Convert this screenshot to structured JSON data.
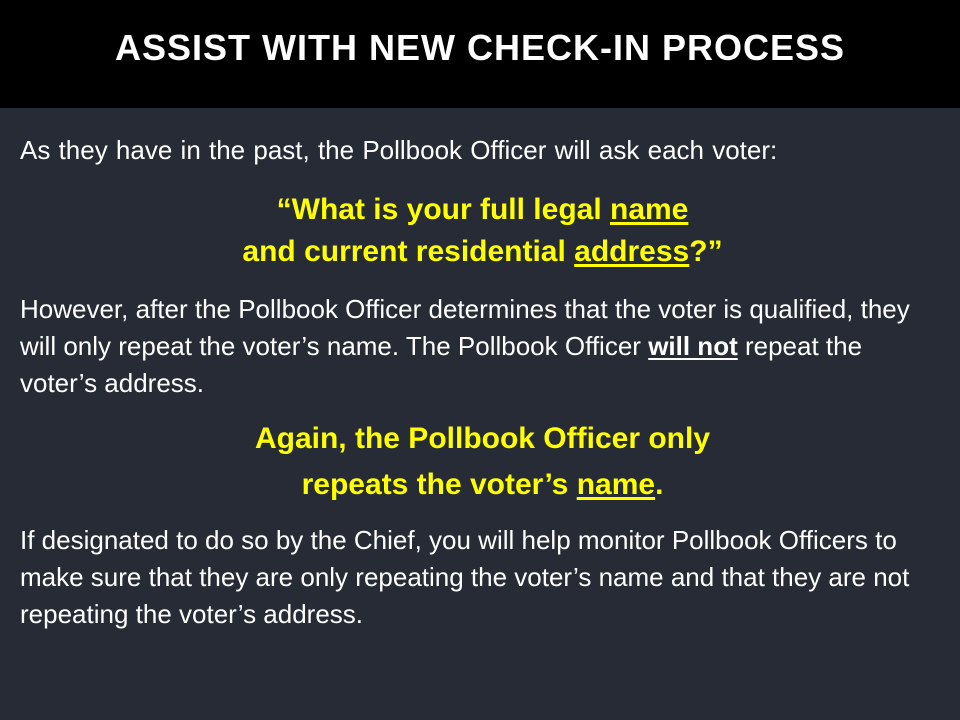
{
  "title": "ASSIST WITH NEW CHECK-IN PROCESS",
  "intro": "As they have in the past, the Pollbook Officer will ask each voter:",
  "quote": {
    "line1_prefix": "“What is your full legal ",
    "line1_underlined": "name",
    "line2_prefix": "and current residential ",
    "line2_underlined": "address",
    "line2_suffix": "?”"
  },
  "paragraph2": {
    "text_before": "However, after the Pollbook Officer determines that the voter is qualified, they will only repeat the voter’s name. The Pollbook Officer ",
    "emphasis": "will not",
    "text_after": " repeat the voter’s address."
  },
  "callout": {
    "line1": "Again, the Pollbook Officer only",
    "line2_prefix": "repeats the voter’s ",
    "line2_underlined": "name",
    "line2_suffix": "."
  },
  "paragraph3": "If designated to do so by the Chief, you will help monitor Pollbook Officers to make sure that they are only repeating the voter’s name and that they are not repeating the voter’s address.",
  "colors": {
    "background": "#262b36",
    "title_bar": "#000000",
    "accent_yellow": "#ffff00",
    "text": "#ffffff"
  }
}
